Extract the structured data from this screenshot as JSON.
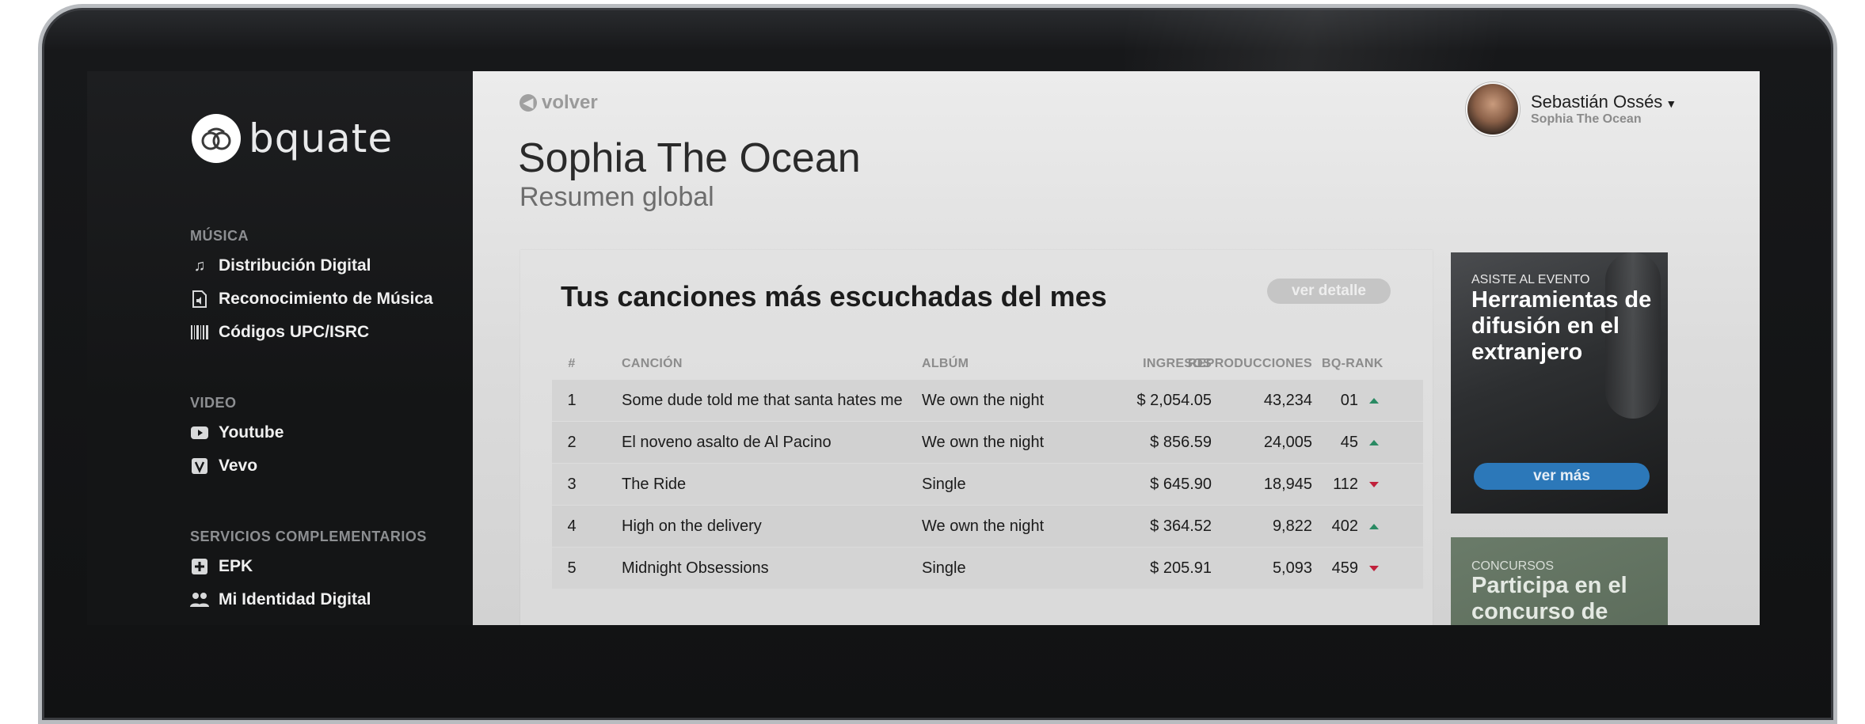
{
  "brand": {
    "logo_text": "bquate"
  },
  "sidebar": {
    "sections": [
      {
        "title": "MÚSICA",
        "items": [
          {
            "label": "Distribución Digital",
            "icon": "music-note-icon"
          },
          {
            "label": "Reconocimiento de Música",
            "icon": "audio-file-icon"
          },
          {
            "label": "Códigos UPC/ISRC",
            "icon": "barcode-icon"
          }
        ]
      },
      {
        "title": "VIDEO",
        "items": [
          {
            "label": "Youtube",
            "icon": "youtube-icon"
          },
          {
            "label": "Vevo",
            "icon": "vevo-icon"
          }
        ]
      },
      {
        "title": "SERVICIOS COMPLEMENTARIOS",
        "items": [
          {
            "label": "EPK",
            "icon": "plus-square-icon"
          },
          {
            "label": "Mi Identidad Digital",
            "icon": "users-icon"
          }
        ]
      }
    ]
  },
  "header": {
    "back_label": "volver",
    "title": "Sophia The Ocean",
    "subtitle": "Resumen global",
    "user": {
      "name": "Sebastián Ossés",
      "artist": "Sophia The Ocean"
    }
  },
  "top_songs": {
    "title": "Tus canciones más escuchadas del mes",
    "detail_button": "ver detalle",
    "columns": [
      "#",
      "CANCIÓN",
      "ALBÚM",
      "INGRESOS",
      "REPRODUCCIONES",
      "BQ-RANK"
    ],
    "rows": [
      {
        "num": "1",
        "song": "Some dude told me that santa hates me",
        "album": "We own the night",
        "income": "$ 2,054.05",
        "plays": "43,234",
        "rank": "01",
        "trend": "up"
      },
      {
        "num": "2",
        "song": "El noveno asalto de Al Pacino",
        "album": "We own the night",
        "income": "$ 856.59",
        "plays": "24,005",
        "rank": "45",
        "trend": "up"
      },
      {
        "num": "3",
        "song": "The Ride",
        "album": "Single",
        "income": "$ 645.90",
        "plays": "18,945",
        "rank": "112",
        "trend": "down"
      },
      {
        "num": "4",
        "song": "High on the delivery",
        "album": "We own the night",
        "income": "$ 364.52",
        "plays": "9,822",
        "rank": "402",
        "trend": "up"
      },
      {
        "num": "5",
        "song": "Midnight Obsessions",
        "album": "Single",
        "income": "$ 205.91",
        "plays": "5,093",
        "rank": "459",
        "trend": "down"
      }
    ]
  },
  "promos": [
    {
      "kicker": "ASISTE AL EVENTO",
      "title": "Herramientas de difusión en el extranjero",
      "button": "ver más"
    },
    {
      "kicker": "CONCURSOS",
      "title": "Participa en el concurso de"
    }
  ],
  "colors": {
    "accent_blue": "#2c78b9",
    "trend_up": "#2a8a63",
    "trend_down": "#c0203b"
  }
}
